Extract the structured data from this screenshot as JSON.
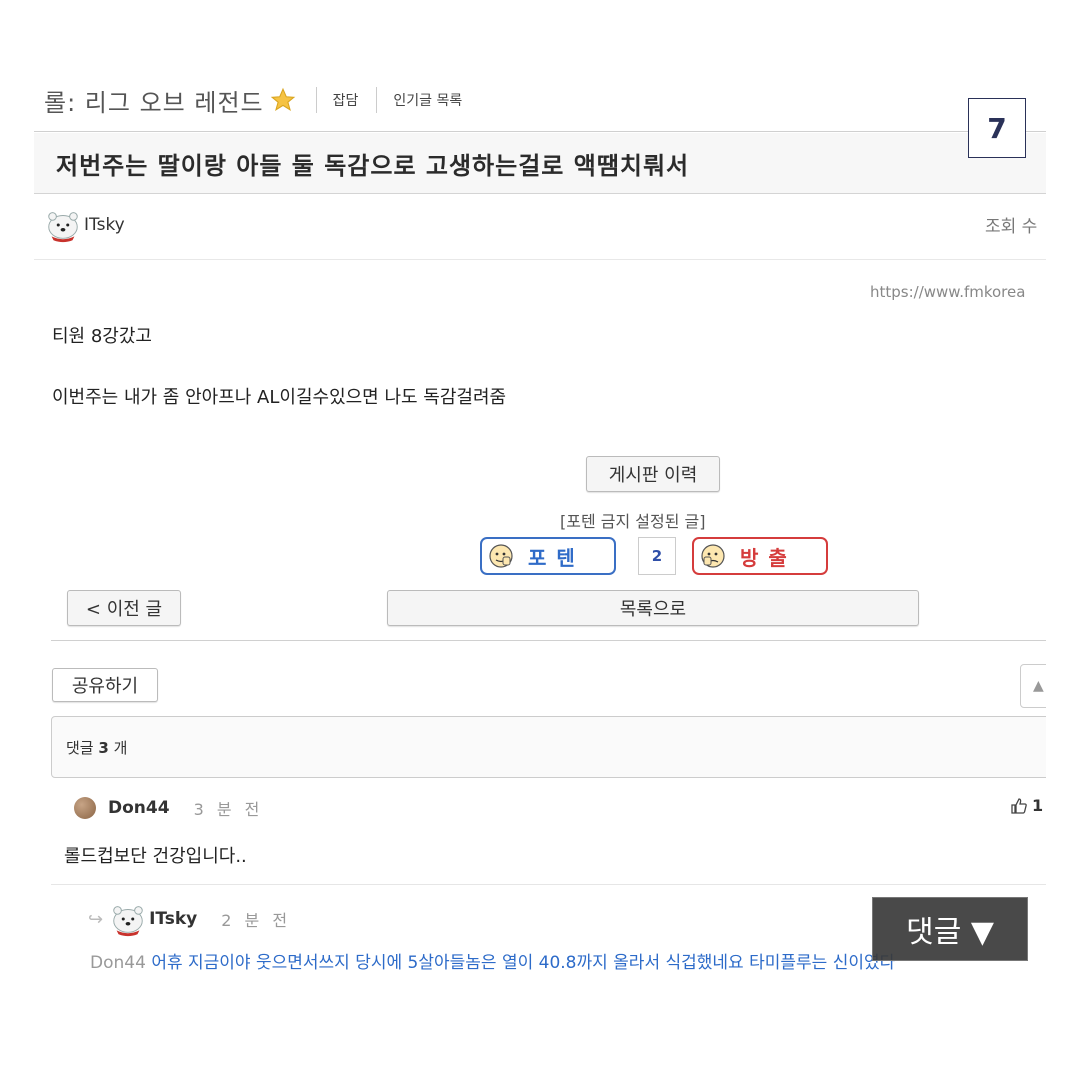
{
  "board": {
    "name": "롤: 리그 오브 레전드",
    "category": "잡담",
    "popular_link": "인기글 목록"
  },
  "page_badge": "7",
  "post": {
    "title": "저번주는 딸이랑 아들 둘 독감으로 고생하는걸로 액땜치뤄서",
    "author": "ITsky",
    "views_label": "조회 수",
    "url": "https://www.fmkorea",
    "body": [
      "티원 8강갔고",
      "이번주는 내가 좀 안아프나 AL이길수있으면 나도 독감걸려줌"
    ]
  },
  "history_button": "게시판 이력",
  "restriction_note": "[포텐 금지 설정된 글]",
  "vote": {
    "up_label": "포텐",
    "count": "2",
    "down_label": "방출"
  },
  "nav": {
    "prev_label": "< 이전 글",
    "list_label": "목록으로"
  },
  "share_label": "공유하기",
  "comments": {
    "header_prefix": "댓글",
    "count": "3",
    "header_suffix": "개",
    "items": [
      {
        "author": "Don44",
        "time": "3 분 전",
        "likes": "1",
        "text": "롤드컵보단 건강입니다.."
      },
      {
        "author": "ITsky",
        "time": "2 분 전",
        "reply_to": "Don44",
        "text": "어휴 지금이야 웃으면서쓰지 당시에 5살아들놈은 열이 40.8까지 올라서 식겁했네요 타미플루는 신이였다"
      }
    ]
  },
  "comment_fab": "댓글 ▼",
  "colors": {
    "potent_blue": "#2f6bc8",
    "banish_red": "#d53c3c",
    "reply_blue": "#2d6bc9",
    "badge_navy": "#2a3158"
  }
}
